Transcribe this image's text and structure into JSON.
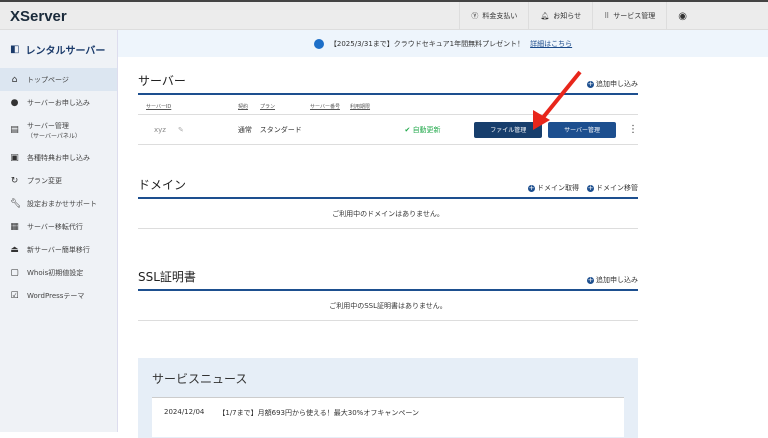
{
  "header": {
    "logo": "XServer",
    "nav": [
      {
        "icon": "yen-icon",
        "label": "料金支払い"
      },
      {
        "icon": "bell-icon",
        "label": "お知らせ"
      },
      {
        "icon": "grid-icon",
        "label": "サービス管理"
      }
    ]
  },
  "sidebar": {
    "brand": "レンタルサーバー",
    "items": [
      {
        "icon": "home-icon",
        "label": "トップページ"
      },
      {
        "icon": "plus-circle-icon",
        "label": "サーバーお申し込み"
      },
      {
        "icon": "server-icon",
        "label": "サーバー管理",
        "sub": "（サーバーパネル）"
      },
      {
        "icon": "gift-icon",
        "label": "各種特典お申し込み"
      },
      {
        "icon": "refresh-icon",
        "label": "プラン変更"
      },
      {
        "icon": "wrench-icon",
        "label": "設定おまかせサポート"
      },
      {
        "icon": "transfer-icon",
        "label": "サーバー移転代行"
      },
      {
        "icon": "upload-icon",
        "label": "新サーバー簡単移行"
      },
      {
        "icon": "whois-icon",
        "label": "Whois初期値設定"
      },
      {
        "icon": "wordpress-icon",
        "label": "WordPressテーマ"
      }
    ]
  },
  "banner": {
    "text": "【2025/3/31まで】クラウドセキュア1年間無料プレゼント！",
    "link": "詳細はこちら"
  },
  "server": {
    "title": "サーバー",
    "add": "追加申し込み",
    "columns": [
      "サーバーID",
      "契約",
      "プラン",
      "サーバー番号",
      "利用期限"
    ],
    "row": {
      "id": "xyz",
      "contract": "通常",
      "plan": "スタンダード",
      "status": "自動更新",
      "file_btn": "ファイル管理",
      "manage_btn": "サーバー管理"
    }
  },
  "domain": {
    "title": "ドメイン",
    "get": "ドメイン取得",
    "transfer": "ドメイン移管",
    "empty": "ご利用中のドメインはありません。"
  },
  "ssl": {
    "title": "SSL証明書",
    "add": "追加申し込み",
    "empty": "ご利用中のSSL証明書はありません。"
  },
  "news": {
    "title": "サービスニュース",
    "items": [
      {
        "date": "2024/12/04",
        "text": "【1/7まで】月額693円から使える！最大30%オフキャンペーン"
      }
    ]
  },
  "colors": {
    "primary": "#1d4f8f",
    "dark_btn": "#173e6c",
    "arrow": "#e8261b",
    "ok": "#22a94b"
  }
}
